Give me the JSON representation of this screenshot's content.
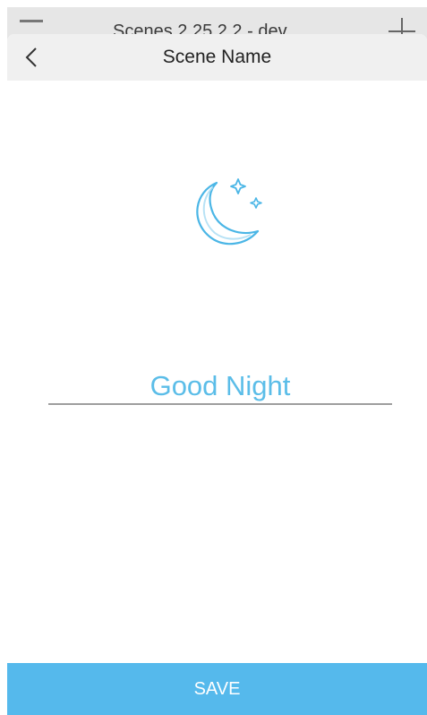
{
  "underlay": {
    "title": "Scenes 2.25.2.2 - dev"
  },
  "sheet": {
    "title": "Scene Name",
    "back_icon": "chevron-left-icon"
  },
  "scene": {
    "icon": "moon-stars-icon",
    "name_value": "Good Night"
  },
  "actions": {
    "save_label": "SAVE"
  },
  "colors": {
    "accent": "#55b9ec",
    "input_text": "#5bbde8",
    "header_bg": "#f0f0f0"
  }
}
